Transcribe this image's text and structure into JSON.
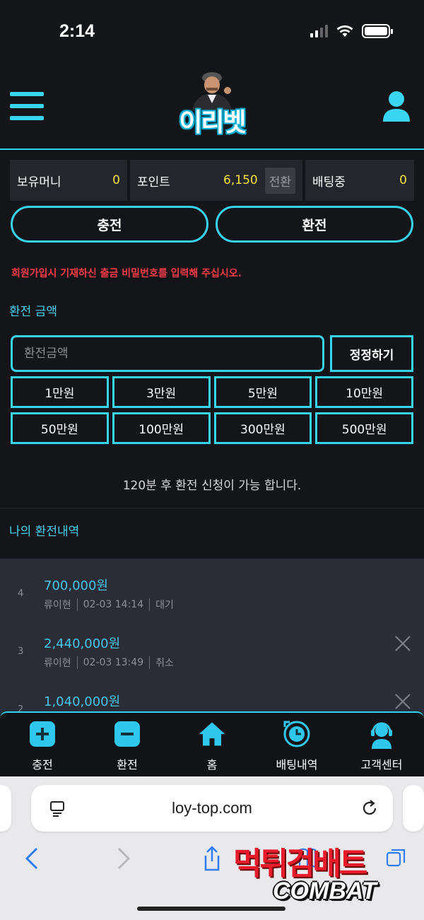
{
  "status": {
    "time": "2:14"
  },
  "brand": {
    "logo_text": "이리벳"
  },
  "balances": {
    "money_label": "보유머니",
    "money_value": "0",
    "point_label": "포인트",
    "point_value": "6,150",
    "convert_label": "전환",
    "betting_label": "배팅중",
    "betting_value": "0"
  },
  "actions": {
    "deposit_label": "충전",
    "withdraw_label": "환전"
  },
  "notice": "회원가입시 기재하신 출금 비밀번호를 입력해 주십시오.",
  "withdraw_form": {
    "section_title": "환전 금액",
    "amount_placeholder": "환전금액",
    "reset_label": "정정하기",
    "presets": [
      "1만원",
      "3만원",
      "5만원",
      "10만원",
      "50만원",
      "100만원",
      "300만원",
      "500만원"
    ],
    "wait_message": "120분 후 환전 신청이 가능 합니다."
  },
  "history": {
    "section_title": "나의 환전내역",
    "items": [
      {
        "no": "4",
        "amount": "700,000원",
        "name": "류이현",
        "datetime": "02-03 14:14",
        "status": "대기"
      },
      {
        "no": "3",
        "amount": "2,440,000원",
        "name": "류이현",
        "datetime": "02-03 13:49",
        "status": "취소"
      },
      {
        "no": "2",
        "amount": "1,040,000원",
        "name": "",
        "datetime": "",
        "status": ""
      }
    ]
  },
  "bottom_nav": [
    "충전",
    "환전",
    "홈",
    "배팅내역",
    "고객센터"
  ],
  "browser": {
    "url": "loy-top.com"
  },
  "watermark": {
    "line1": "먹튀검배트",
    "line2": "COMBAT"
  },
  "colors": {
    "accent": "#36d4f0",
    "value_yellow": "#f5e43a",
    "notice_red": "#ff3b47",
    "history_bg": "#2a2d36"
  }
}
